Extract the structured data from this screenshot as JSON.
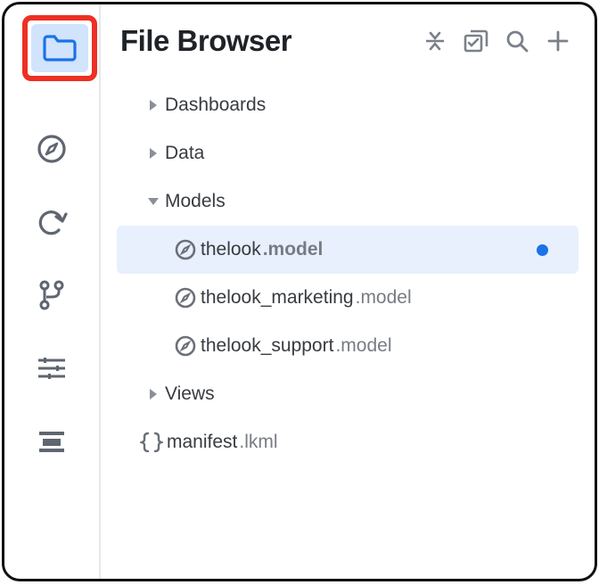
{
  "header": {
    "title": "File Browser"
  },
  "tree": {
    "dashboards": {
      "label": "Dashboards"
    },
    "data": {
      "label": "Data"
    },
    "models": {
      "label": "Models",
      "items": [
        {
          "name": "thelook",
          "ext": ".model",
          "modified": true,
          "selected": true
        },
        {
          "name": "thelook_marketing",
          "ext": ".model"
        },
        {
          "name": "thelook_support",
          "ext": ".model"
        }
      ]
    },
    "views": {
      "label": "Views"
    },
    "manifest": {
      "name": "manifest",
      "ext": ".lkml"
    }
  }
}
